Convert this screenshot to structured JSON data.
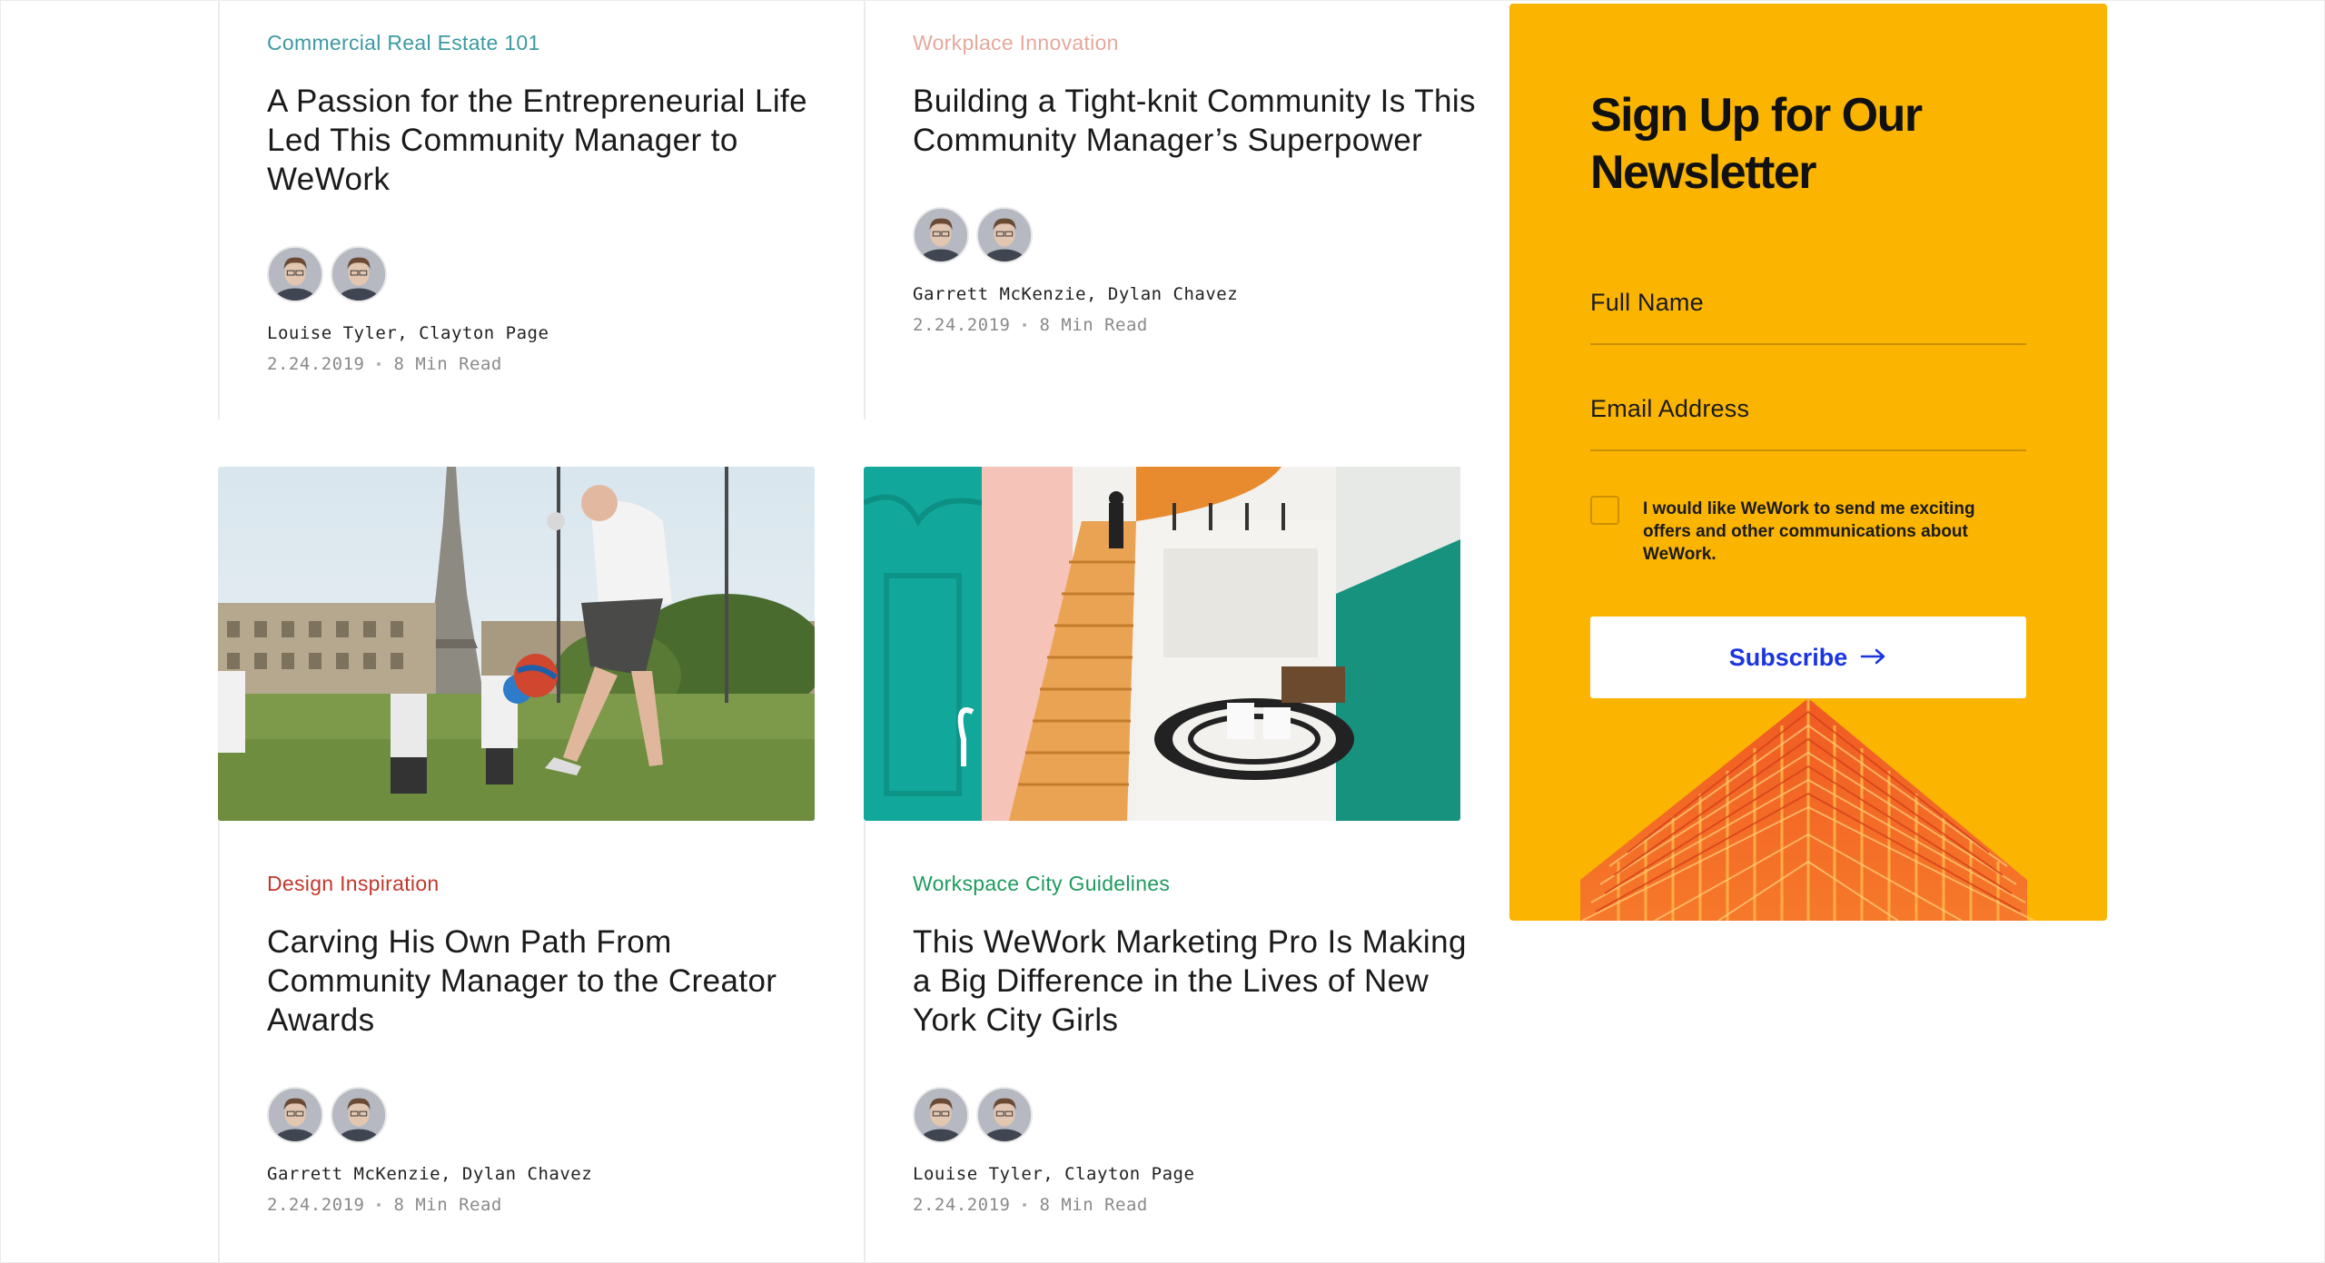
{
  "articles": [
    {
      "category": "Commercial Real Estate 101",
      "category_color": "#3b9aa0",
      "title": "A Passion for the Entrepreneurial Life Led This Community Manager to WeWork",
      "authors": "Louise Tyler, Clayton Page",
      "date": "2.24.2019",
      "read_time": "8 Min Read"
    },
    {
      "category": "Workplace Innovation",
      "category_color": "#e6a89c",
      "title": "Building a Tight-knit Community Is This Community Manager’s Superpower",
      "authors": "Garrett McKenzie, Dylan Chavez",
      "date": "2.24.2019",
      "read_time": "8 Min Read"
    },
    {
      "category": "Design Inspiration",
      "category_color": "#c0392b",
      "title": "Carving His Own Path From Community Manager to the Creator Awards",
      "authors": "Garrett McKenzie, Dylan Chavez",
      "date": "2.24.2019",
      "read_time": "8 Min Read"
    },
    {
      "category": "Workspace City Guidelines",
      "category_color": "#1e9b5e",
      "title": "This WeWork Marketing Pro Is Making a Big Difference in the Lives of New York City Girls",
      "authors": "Louise Tyler, Clayton Page",
      "date": "2.24.2019",
      "read_time": "8 Min Read"
    }
  ],
  "newsletter": {
    "title": "Sign Up for Our Newsletter",
    "full_name_label": "Full Name",
    "email_label": "Email Address",
    "consent_text": "I would like WeWork to send me exciting offers and other communications about WeWork.",
    "subscribe_label": "Subscribe",
    "background_color": "#fbb500",
    "button_text_color": "#1b35e0"
  },
  "icons": {
    "arrow": "arrow-right-icon",
    "avatar": "avatar-photo"
  }
}
